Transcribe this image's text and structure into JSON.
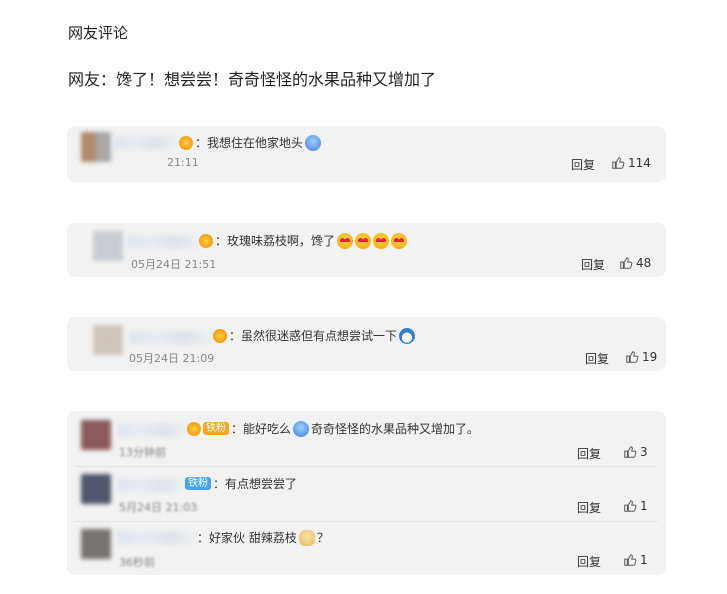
{
  "section_title": "网友评论",
  "headline": "网友：馋了！想尝尝！奇奇怪怪的水果品种又增加了",
  "reply_label": "回复",
  "cards": [
    {
      "comments": [
        {
          "text": "：我想住在他家地头",
          "time": "21:11",
          "likes": "114",
          "emoji": "drool-icon"
        }
      ]
    },
    {
      "comments": [
        {
          "text": "：玫瑰味荔枝啊，馋了",
          "time": "05月24日 21:51",
          "likes": "48",
          "emoji": "heart-eyes-icon"
        }
      ]
    },
    {
      "comments": [
        {
          "text": "：虽然很迷惑但有点想尝试一下",
          "time": "05月24日 21:09",
          "likes": "19",
          "emoji": "doraemon-icon"
        }
      ]
    },
    {
      "comments": [
        {
          "badge": "铁粉",
          "text": "：能好吃么",
          "quote": "奇奇怪怪的水果品种又增加了。",
          "time": "13分钟前",
          "likes": "3",
          "emoji": "drool-icon"
        },
        {
          "badge": "铁粉",
          "text": "：有点想尝尝了",
          "time": "5月24日 21:03",
          "likes": "1"
        },
        {
          "text": "：好家伙 甜辣荔枝",
          "suffix": "？",
          "time": "36秒前",
          "likes": "1",
          "emoji": "doge-icon"
        }
      ]
    }
  ],
  "colors": {
    "card_bg": "#f2f2f2",
    "badge_orange": "#f5a623",
    "badge_blue": "#4aa3f0"
  }
}
